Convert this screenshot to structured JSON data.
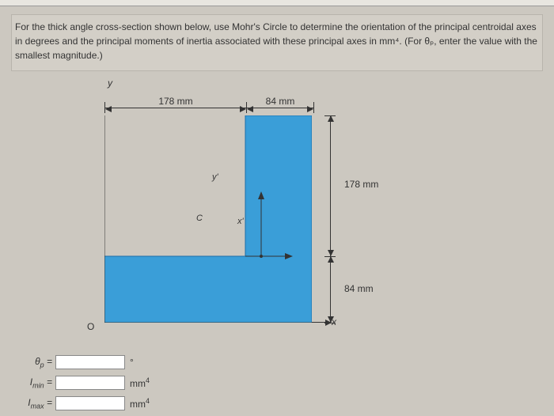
{
  "question": {
    "text": "For the thick angle cross-section shown below, use Mohr's Circle to determine the orientation of the principal centroidal axes in degrees and the principal moments of inertia associated with these principal axes in mm⁴. (For θₚ, enter the value with the smallest magnitude.)"
  },
  "diagram": {
    "y_axis_label": "y",
    "x_axis_label": "x",
    "origin_label": "O",
    "centroid_label": "C",
    "yprime_label": "y'",
    "xprime_label": "x'",
    "dim_top_1": "178 mm",
    "dim_top_2": "84 mm",
    "dim_right_1": "178 mm",
    "dim_right_2": "84 mm",
    "shape_color": "#3a9ed8"
  },
  "answers": {
    "rows": [
      {
        "label_html": "θₚ =",
        "unit": "°"
      },
      {
        "label_html": "Iₘᵢₙ =",
        "unit": "mm⁴"
      },
      {
        "label_html": "Iₘₐₓ =",
        "unit": "mm⁴"
      }
    ],
    "theta_label_base": "θ",
    "theta_label_sub": "p",
    "imin_label_base": "I",
    "imin_label_sub": "min",
    "imax_label_base": "I",
    "imax_label_sub": "max",
    "equals": "=",
    "unit_deg": "°",
    "unit_mm4_base": "mm",
    "unit_mm4_sup": "4"
  }
}
